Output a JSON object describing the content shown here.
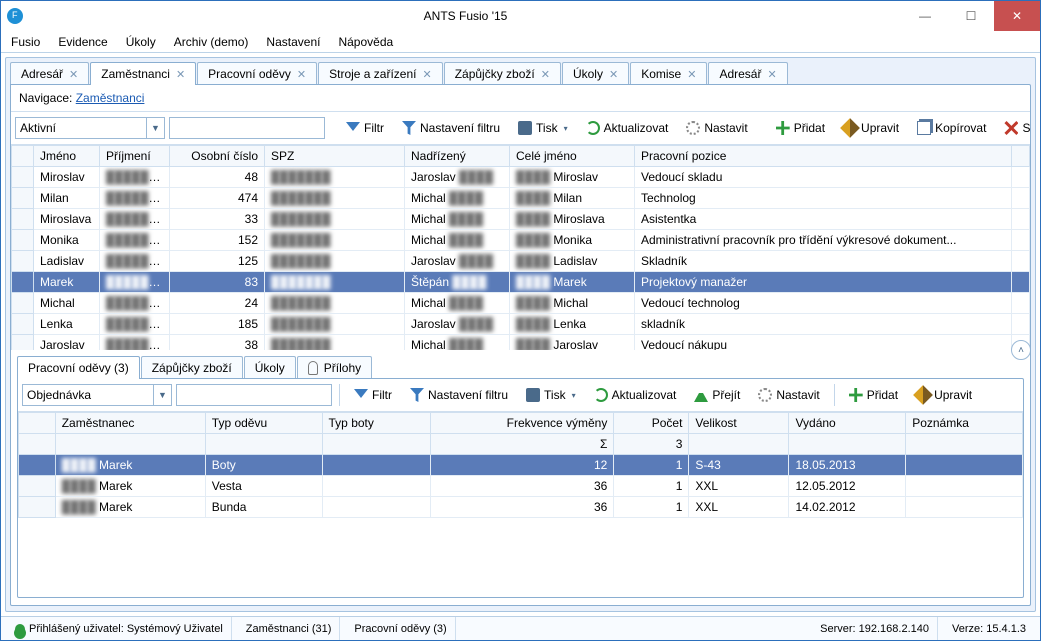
{
  "window": {
    "title": "ANTS Fusio '15"
  },
  "menu": [
    "Fusio",
    "Evidence",
    "Úkoly",
    "Archiv (demo)",
    "Nastavení",
    "Nápověda"
  ],
  "tabs": [
    {
      "label": "Adresář",
      "close": true
    },
    {
      "label": "Zaměstnanci",
      "close": true,
      "active": true
    },
    {
      "label": "Pracovní oděvy",
      "close": true
    },
    {
      "label": "Stroje a zařízení",
      "close": true
    },
    {
      "label": "Zápůjčky zboží",
      "close": true
    },
    {
      "label": "Úkoly",
      "close": true
    },
    {
      "label": "Komise",
      "close": true
    },
    {
      "label": "Adresář",
      "close": true
    }
  ],
  "nav": {
    "label": "Navigace:",
    "link": "Zaměstnanci"
  },
  "toolbar1": {
    "combo": "Aktivní",
    "filter": "Filtr",
    "filterSettings": "Nastavení filtru",
    "print": "Tisk",
    "refresh": "Aktualizovat",
    "setup": "Nastavit",
    "add": "Přidat",
    "edit": "Upravit",
    "copy": "Kopírovat",
    "delete": "Smazat"
  },
  "grid1": {
    "headers": [
      "",
      "Jméno",
      "Příjmení",
      "Osobní číslo",
      "SPZ",
      "Nadřízený",
      "Celé jméno",
      "Pracovní pozice",
      ""
    ],
    "rows": [
      {
        "jm": "Miroslav",
        "oc": "48",
        "nad": "Jaroslav",
        "cj": "Miroslav",
        "pp": "Vedoucí skladu"
      },
      {
        "jm": "Milan",
        "oc": "474",
        "nad": "Michal",
        "cj": "Milan",
        "pp": "Technolog"
      },
      {
        "jm": "Miroslava",
        "oc": "33",
        "nad": "Michal",
        "cj": "Miroslava",
        "pp": "Asistentka"
      },
      {
        "jm": "Monika",
        "oc": "152",
        "nad": "Michal",
        "cj": "Monika",
        "pp": "Administrativní pracovník pro třídění výkresové dokument..."
      },
      {
        "jm": "Ladislav",
        "oc": "125",
        "nad": "Jaroslav",
        "cj": "Ladislav",
        "pp": "Skladník"
      },
      {
        "jm": "Marek",
        "oc": "83",
        "nad": "Štěpán",
        "cj": "Marek",
        "pp": "Projektový manažer",
        "sel": true
      },
      {
        "jm": "Michal",
        "oc": "24",
        "nad": "Michal",
        "cj": "Michal",
        "pp": "Vedoucí technolog"
      },
      {
        "jm": "Lenka",
        "oc": "185",
        "nad": "Jaroslav",
        "cj": "Lenka",
        "pp": "skladník"
      },
      {
        "jm": "Jaroslav",
        "oc": "38",
        "nad": "Michal",
        "cj": "Jaroslav",
        "pp": "Vedoucí nákupu"
      }
    ]
  },
  "subtabs": [
    {
      "label": "Pracovní oděvy (3)",
      "active": true
    },
    {
      "label": "Zápůjčky zboží"
    },
    {
      "label": "Úkoly"
    },
    {
      "label": "Přílohy",
      "icon": "clip"
    }
  ],
  "toolbar2": {
    "combo": "Objednávka",
    "filter": "Filtr",
    "filterSettings": "Nastavení filtru",
    "print": "Tisk",
    "refresh": "Aktualizovat",
    "go": "Přejít",
    "setup": "Nastavit",
    "add": "Přidat",
    "edit": "Upravit"
  },
  "grid2": {
    "headers": [
      "",
      "Zaměstnanec",
      "Typ oděvu",
      "Typ boty",
      "Frekvence výměny",
      "Počet",
      "Velikost",
      "Vydáno",
      "Poznámka"
    ],
    "sum": {
      "sigma": "Σ",
      "count": "3"
    },
    "rows": [
      {
        "zam": "Marek",
        "typ": "Boty",
        "freq": "12",
        "poc": "1",
        "vel": "S-43",
        "vyd": "18.05.2013",
        "sel": true
      },
      {
        "zam": "Marek",
        "typ": "Vesta",
        "freq": "36",
        "poc": "1",
        "vel": "XXL",
        "vyd": "12.05.2012"
      },
      {
        "zam": "Marek",
        "typ": "Bunda",
        "freq": "36",
        "poc": "1",
        "vel": "XXL",
        "vyd": "14.02.2012"
      }
    ]
  },
  "status": {
    "user_label": "Přihlášený uživatel: Systémový Uživatel",
    "emp": "Zaměstnanci (31)",
    "cloth": "Pracovní oděvy (3)",
    "server": "Server: 192.168.2.140",
    "ver": "Verze: 15.4.1.3"
  }
}
